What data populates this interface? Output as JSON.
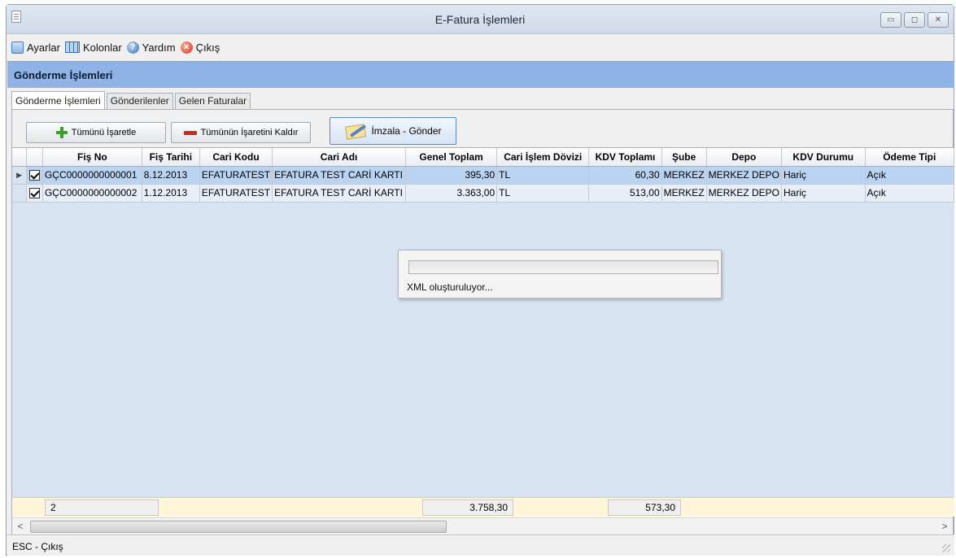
{
  "window": {
    "title": "E-Fatura İşlemleri",
    "controls": [
      "▭",
      "◻",
      "✕"
    ]
  },
  "menu": [
    {
      "label": "Ayarlar",
      "icon": "settings-icon"
    },
    {
      "label": "Kolonlar",
      "icon": "columns-icon"
    },
    {
      "label": "Yardım",
      "icon": "help-icon"
    },
    {
      "label": "Çıkış",
      "icon": "exit-icon"
    }
  ],
  "section": {
    "title": "Gönderme İşlemleri"
  },
  "tabs": [
    {
      "label": "Gönderme İşlemleri",
      "active": true
    },
    {
      "label": "Gönderilenler",
      "active": false
    },
    {
      "label": "Gelen Faturalar",
      "active": false
    }
  ],
  "toolbar": {
    "select_all": "Tümünü İşaretle",
    "unselect_all": "Tümünün İşaretini Kaldır",
    "sign_send": "İmzala - Gönder"
  },
  "grid": {
    "columns": [
      "Fiş No",
      "Fiş Tarihi",
      "Cari Kodu",
      "Cari Adı",
      "Genel Toplam",
      "Cari İşlem Dövizi",
      "KDV Toplamı",
      "Şube",
      "Depo",
      "KDV Durumu",
      "Ödeme Tipi"
    ],
    "rows": [
      {
        "fis_no": "GÇC0000000000001",
        "fis_tarihi": "8.12.2013",
        "cari_kodu": "EFATURATEST",
        "cari_adi": "EFATURA TEST CARİ KARTI",
        "genel_toplam": "395,30",
        "doviz": "TL",
        "kdv_toplam": "60,30",
        "sube": "MERKEZ",
        "depo": "MERKEZ DEPO",
        "kdv_durumu": "Hariç",
        "odeme_tipi": "Açık"
      },
      {
        "fis_no": "GÇC0000000000002",
        "fis_tarihi": "1.12.2013",
        "cari_kodu": "EFATURATEST",
        "cari_adi": "EFATURA TEST CARİ KARTI",
        "genel_toplam": "3.363,00",
        "doviz": "TL",
        "kdv_toplam": "513,00",
        "sube": "MERKEZ",
        "depo": "MERKEZ DEPO",
        "kdv_durumu": "Hariç",
        "odeme_tipi": "Açık"
      }
    ],
    "footer": {
      "count": "2",
      "genel_toplam_sum": "3.758,30",
      "kdv_toplam_sum": "573,30"
    }
  },
  "progress": {
    "text": "XML oluşturuluyor...",
    "value": 0
  },
  "status": {
    "text": "ESC - Çıkış"
  },
  "colors": {
    "header_band": "#8fb3e6",
    "selected_row": "#bad3f2",
    "footer_row": "#fff5d9"
  }
}
